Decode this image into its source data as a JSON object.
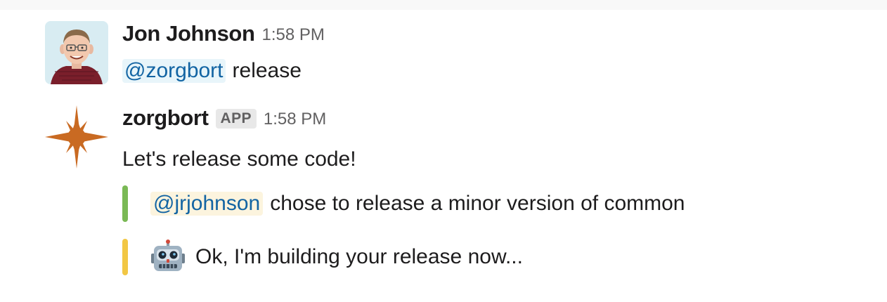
{
  "messages": [
    {
      "sender": "Jon Johnson",
      "time": "1:58 PM",
      "mention": "@zorgbort",
      "text": "release"
    },
    {
      "sender": "zorgbort",
      "badge": "APP",
      "time": "1:58 PM",
      "text": "Let's release some code!",
      "attachments": [
        {
          "mention": "@jrjohnson",
          "text": "chose to release a minor version of common",
          "color": "#7ab955"
        },
        {
          "icon": "robot-face-icon",
          "text": "Ok, I'm building your release now...",
          "color": "#f2c744"
        }
      ]
    }
  ],
  "colors": {
    "mention_text": "#1264a3",
    "mention_bg": "#e8f5fa",
    "self_mention_bg": "#fcf4de",
    "bot_avatar": "#c96a22"
  }
}
